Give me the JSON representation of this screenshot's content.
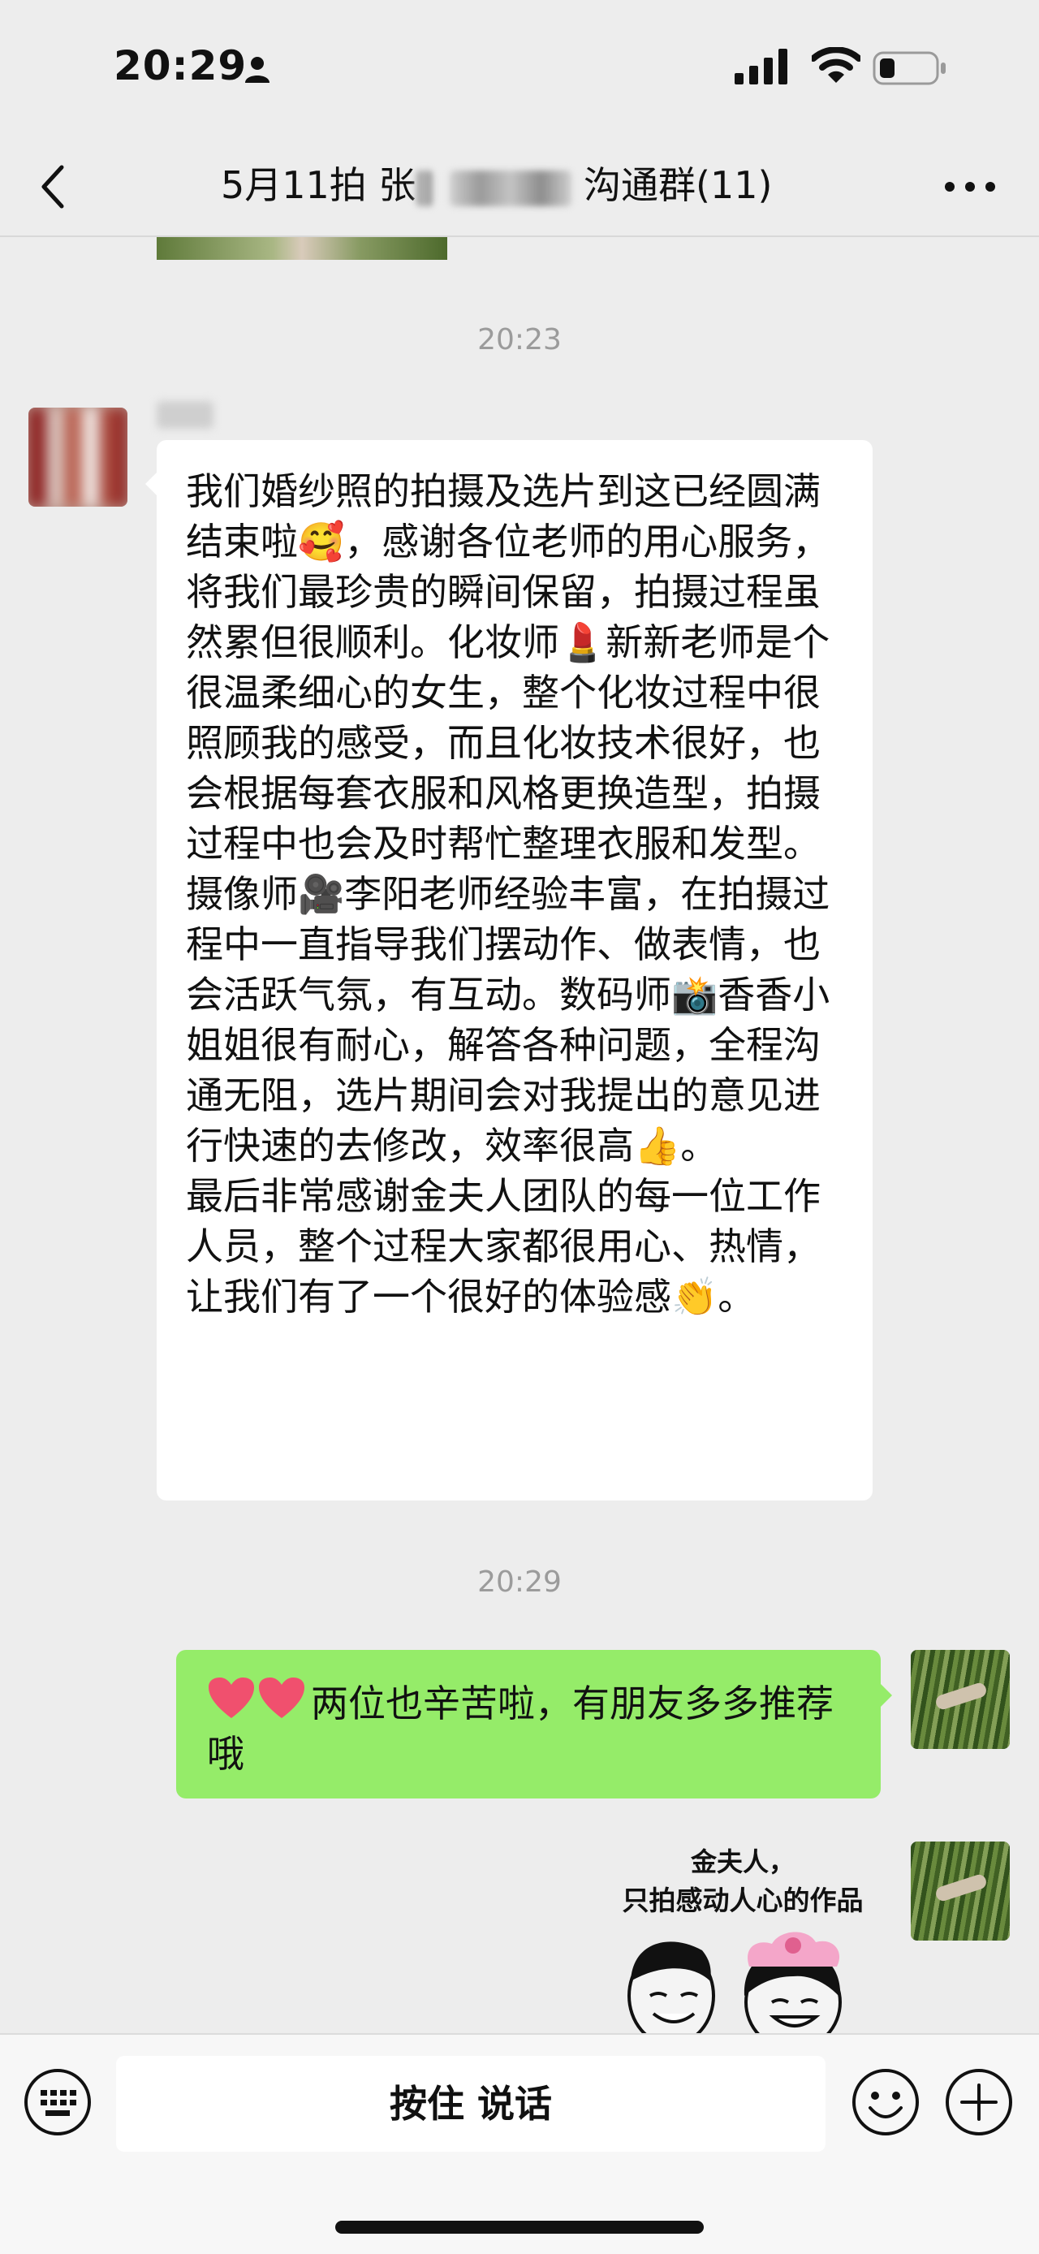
{
  "status_bar": {
    "time": "20:29",
    "icons": [
      "person-icon",
      "signal-icon",
      "wifi-icon",
      "battery-icon"
    ]
  },
  "nav": {
    "title_part1": "5月11拍 张",
    "title_part2": " 沟通群(11)",
    "icons": [
      "chevron-left-icon",
      "more-dots-icon"
    ]
  },
  "messages": {
    "time_1": "20:23",
    "incoming_text": "我们婚纱照的拍摄及选片到这已经圆满结束啦🥰，感谢各位老师的用心服务，将我们最珍贵的瞬间保留，拍摄过程虽然累但很顺利。化妆师💄新新老师是个很温柔细心的女生，整个化妆过程中很照顾我的感受，而且化妆技术很好，也会根据每套衣服和风格更换造型，拍摄过程中也会及时帮忙整理衣服和发型。摄像师🎥李阳老师经验丰富，在拍摄过程中一直指导我们摆动作、做表情，也会活跃气氛，有互动。数码师📸香香小姐姐很有耐心，解答各种问题，全程沟通无阻，选片期间会对我提出的意见进行快速的去修改，效率很高👍。\n最后非常感谢金夫人团队的每一位工作人员，整个过程大家都很用心、热情，让我们有了一个很好的体验感👏。",
    "time_2": "20:29",
    "outgoing_text": "两位也辛苦啦，有朋友多多推荐哦",
    "sticker_line1": "金夫人，",
    "sticker_line2": "只拍感动人心的作品"
  },
  "input_bar": {
    "hold_to_talk": "按住 说话",
    "icons": [
      "keyboard-icon",
      "emoji-icon",
      "plus-icon"
    ]
  },
  "colors": {
    "background": "#ededed",
    "outgoing_bubble": "#95ec69",
    "incoming_bubble": "#ffffff",
    "timestamp": "#9b9b9b"
  }
}
